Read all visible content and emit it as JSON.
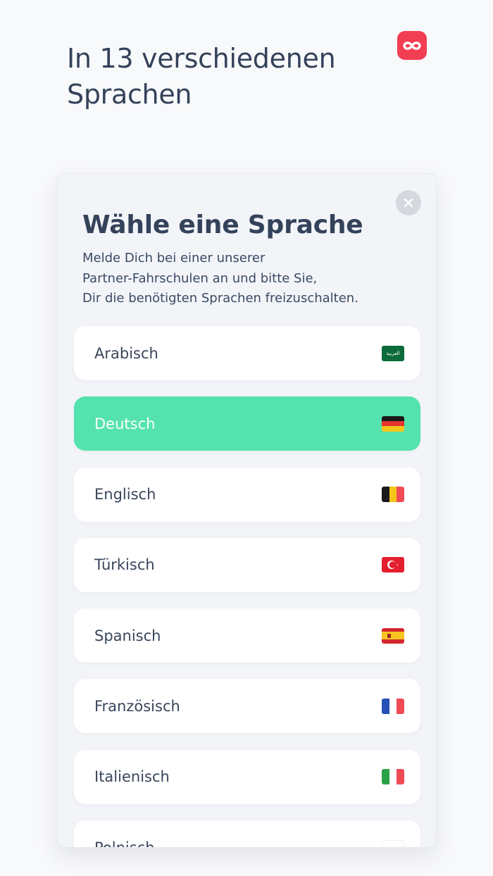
{
  "headline": {
    "line1": "In 13 verschiedenen",
    "line2": "Sprachen"
  },
  "brand": {
    "accent": "#f23e52",
    "selected_color": "#54e3ae"
  },
  "modal": {
    "title": "Wähle eine Sprache",
    "description": [
      "Melde Dich bei einer unserer",
      "Partner-Fahrschulen an und bitte Sie,",
      "Dir die benötigten Sprachen freizuschalten."
    ],
    "close_icon": "close-icon"
  },
  "languages": [
    {
      "label": "Arabisch",
      "flag": "flag-saudi-arabia-icon",
      "flag_text": "العربية",
      "selected": false
    },
    {
      "label": "Deutsch",
      "flag": "flag-germany-icon",
      "selected": true
    },
    {
      "label": "Englisch",
      "flag": "flag-belgium-icon",
      "selected": false
    },
    {
      "label": "Türkisch",
      "flag": "flag-turkey-icon",
      "selected": false
    },
    {
      "label": "Spanisch",
      "flag": "flag-spain-icon",
      "selected": false
    },
    {
      "label": "Französisch",
      "flag": "flag-france-icon",
      "selected": false
    },
    {
      "label": "Italienisch",
      "flag": "flag-italy-icon",
      "selected": false
    },
    {
      "label": "Polnisch",
      "flag": "flag-poland-icon",
      "selected": false
    }
  ]
}
